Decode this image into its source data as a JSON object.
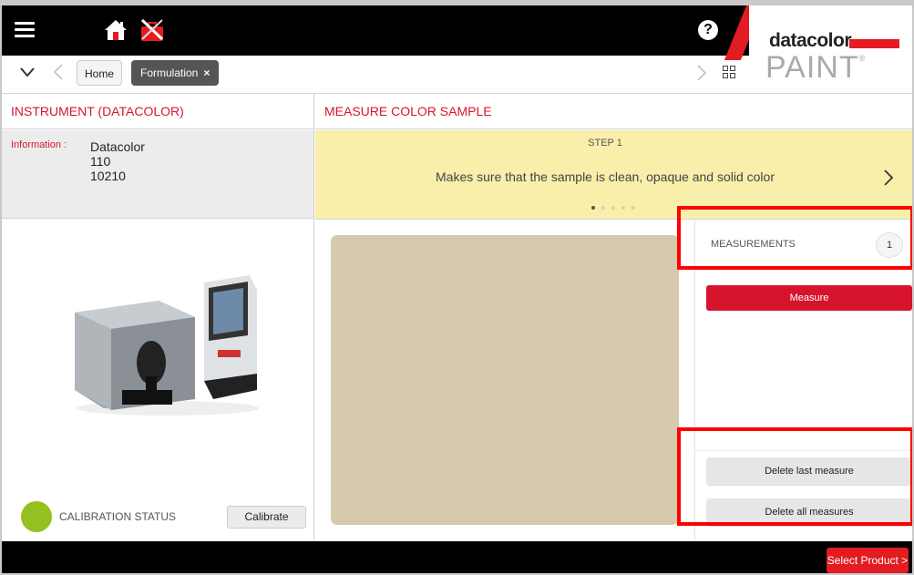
{
  "header": {
    "brand_name": "datacolor",
    "brand_product": "PAINT",
    "brand_trademark": "®",
    "help_glyph": "?"
  },
  "breadcrumb": {
    "home_label": "Home",
    "current_label": "Formulation",
    "close_glyph": "×"
  },
  "left_panel": {
    "title": "INSTRUMENT (DATACOLOR)",
    "info_label": "Information :",
    "info_lines": [
      "Datacolor",
      "110",
      "10210"
    ],
    "calibration_label": "CALIBRATION STATUS",
    "calibration_status_color": "#94c11f",
    "calibrate_label": "Calibrate"
  },
  "right_panel": {
    "title": "MEASURE COLOR SAMPLE",
    "step_label": "STEP 1",
    "step_text": "Makes sure that the sample is clean, opaque and solid color",
    "step_count": 5,
    "step_active_index": 0,
    "sample_color": "#d6c9ad",
    "measurements_label": "MEASUREMENTS",
    "measurements_count": "1",
    "measure_label": "Measure",
    "delete_last_label": "Delete last measure",
    "delete_all_label": "Delete all measures"
  },
  "footer": {
    "select_product_label": "Select Product >"
  },
  "colors": {
    "accent_red": "#e31b23",
    "title_red": "#d7142e",
    "banner_yellow": "#f9eeaa",
    "calibration_ok": "#94c11f"
  }
}
